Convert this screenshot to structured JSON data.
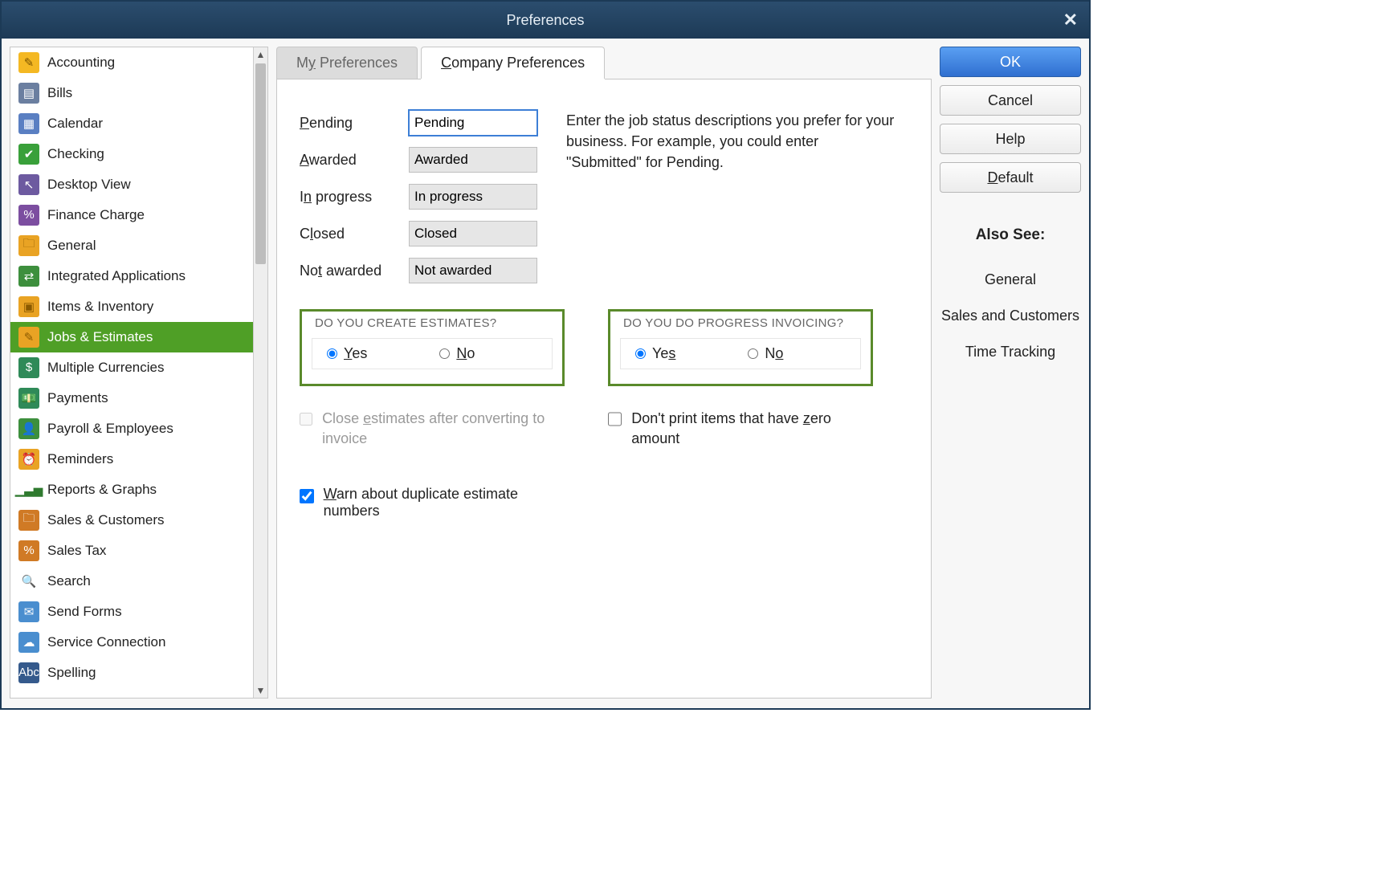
{
  "window": {
    "title": "Preferences"
  },
  "sidebar": {
    "items": [
      {
        "label": "Accounting",
        "icon_bg": "#f4b823",
        "icon_fg": "#7a5300",
        "glyph": "✎"
      },
      {
        "label": "Bills",
        "icon_bg": "#6b7fa0",
        "icon_fg": "#fff",
        "glyph": "▤"
      },
      {
        "label": "Calendar",
        "icon_bg": "#5a7fc2",
        "icon_fg": "#fff",
        "glyph": "▦"
      },
      {
        "label": "Checking",
        "icon_bg": "#39a03a",
        "icon_fg": "#fff",
        "glyph": "✔"
      },
      {
        "label": "Desktop View",
        "icon_bg": "#6d5aa0",
        "icon_fg": "#fff",
        "glyph": "↖"
      },
      {
        "label": "Finance Charge",
        "icon_bg": "#7c4ea0",
        "icon_fg": "#fff",
        "glyph": "%"
      },
      {
        "label": "General",
        "icon_bg": "#e9a324",
        "icon_fg": "#8a5a00",
        "glyph": "🗀"
      },
      {
        "label": "Integrated Applications",
        "icon_bg": "#3d8f3d",
        "icon_fg": "#fff",
        "glyph": "⇄"
      },
      {
        "label": "Items & Inventory",
        "icon_bg": "#e9a324",
        "icon_fg": "#8a5a00",
        "glyph": "▣"
      },
      {
        "label": "Jobs & Estimates",
        "icon_bg": "#e9a324",
        "icon_fg": "#8a5a00",
        "glyph": "✎",
        "selected": true
      },
      {
        "label": "Multiple Currencies",
        "icon_bg": "#2f8a58",
        "icon_fg": "#fff",
        "glyph": "$"
      },
      {
        "label": "Payments",
        "icon_bg": "#2f8a58",
        "icon_fg": "#fff",
        "glyph": "💵"
      },
      {
        "label": "Payroll & Employees",
        "icon_bg": "#3d8f3d",
        "icon_fg": "#fff",
        "glyph": "👤"
      },
      {
        "label": "Reminders",
        "icon_bg": "#e9a324",
        "icon_fg": "#8a5a00",
        "glyph": "⏰"
      },
      {
        "label": "Reports & Graphs",
        "icon_bg": "#ffffff",
        "icon_fg": "#2f7a2f",
        "glyph": "▁▃▅"
      },
      {
        "label": "Sales & Customers",
        "icon_bg": "#d07a25",
        "icon_fg": "#fff",
        "glyph": "🗀"
      },
      {
        "label": "Sales Tax",
        "icon_bg": "#d07a25",
        "icon_fg": "#fff",
        "glyph": "%"
      },
      {
        "label": "Search",
        "icon_bg": "#ffffff",
        "icon_fg": "#777",
        "glyph": "🔍"
      },
      {
        "label": "Send Forms",
        "icon_bg": "#4a8ecf",
        "icon_fg": "#fff",
        "glyph": "✉"
      },
      {
        "label": "Service Connection",
        "icon_bg": "#4a8ecf",
        "icon_fg": "#fff",
        "glyph": "☁"
      },
      {
        "label": "Spelling",
        "icon_bg": "#355a8c",
        "icon_fg": "#fff",
        "glyph": "Abc"
      }
    ]
  },
  "tabs": {
    "my_label_pre": "M",
    "my_label_hot": "y",
    "my_label_post": " Preferences",
    "co_label_hot": "C",
    "co_label_post": "ompany Preferences"
  },
  "jobstatus": {
    "description": "Enter the job status descriptions you prefer for your business.  For example, you could enter \"Submitted\" for Pending.",
    "rows": [
      {
        "label_hot": "P",
        "label_post": "ending",
        "value": "Pending"
      },
      {
        "label_hot": "A",
        "label_post": "warded",
        "value": "Awarded"
      },
      {
        "label_pre": "I",
        "label_hot": "n",
        "label_post": " progress",
        "value": "In progress"
      },
      {
        "label_pre": "C",
        "label_hot": "l",
        "label_post": "osed",
        "value": "Closed"
      },
      {
        "label_pre": "No",
        "label_hot": "t",
        "label_post": " awarded",
        "value": "Not awarded"
      }
    ]
  },
  "estimates": {
    "label": "DO YOU CREATE ESTIMATES?",
    "yes_hot": "Y",
    "yes_post": "es",
    "no_hot": "N",
    "no_post": "o",
    "value": "yes"
  },
  "progress": {
    "label": "DO YOU DO PROGRESS INVOICING?",
    "yes_pre": "Ye",
    "yes_hot": "s",
    "no_pre": "N",
    "no_hot": "o",
    "value": "yes"
  },
  "checks": {
    "close_estimates_pre": "Close ",
    "close_estimates_hot": "e",
    "close_estimates_post": "stimates after converting to invoice",
    "close_estimates_checked": false,
    "close_estimates_disabled": true,
    "zero_pre": "Don't print items that have ",
    "zero_hot": "z",
    "zero_post": "ero amount",
    "zero_checked": false,
    "warn_hot": "W",
    "warn_post": "arn about duplicate estimate numbers",
    "warn_checked": true
  },
  "buttons": {
    "ok": "OK",
    "cancel": "Cancel",
    "help": "Help",
    "default_hot": "D",
    "default_post": "efault"
  },
  "also_see": {
    "title": "Also See:",
    "links": [
      "General",
      "Sales and Customers",
      "Time Tracking"
    ]
  }
}
